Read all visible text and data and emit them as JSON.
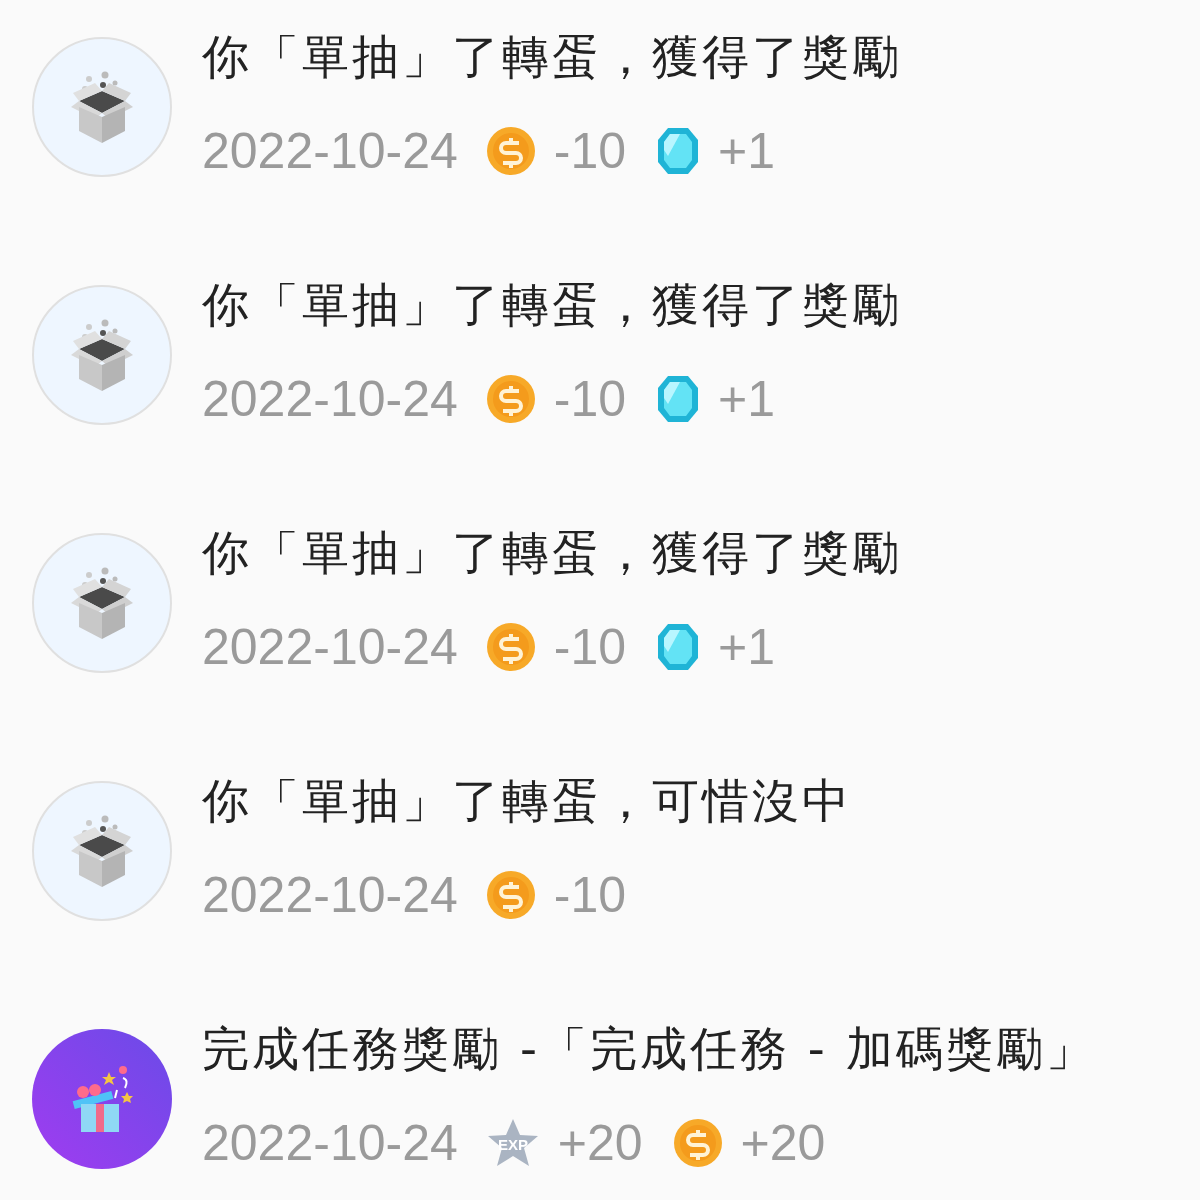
{
  "records": [
    {
      "kind": "box",
      "title": "你「單抽」了轉蛋，獲得了獎勵",
      "date": "2022-10-24",
      "rewards": [
        {
          "kind": "coin",
          "amount": "-10"
        },
        {
          "kind": "gem",
          "amount": "+1"
        }
      ]
    },
    {
      "kind": "box",
      "title": "你「單抽」了轉蛋，獲得了獎勵",
      "date": "2022-10-24",
      "rewards": [
        {
          "kind": "coin",
          "amount": "-10"
        },
        {
          "kind": "gem",
          "amount": "+1"
        }
      ]
    },
    {
      "kind": "box",
      "title": "你「單抽」了轉蛋，獲得了獎勵",
      "date": "2022-10-24",
      "rewards": [
        {
          "kind": "coin",
          "amount": "-10"
        },
        {
          "kind": "gem",
          "amount": "+1"
        }
      ]
    },
    {
      "kind": "box",
      "title": "你「單抽」了轉蛋，可惜沒中",
      "date": "2022-10-24",
      "rewards": [
        {
          "kind": "coin",
          "amount": "-10"
        }
      ]
    },
    {
      "kind": "gift",
      "title": "完成任務獎勵 -「完成任務 - 加碼獎勵」",
      "date": "2022-10-24",
      "rewards": [
        {
          "kind": "exp",
          "label": "EXP",
          "amount": "+20"
        },
        {
          "kind": "coin",
          "amount": "+20"
        }
      ]
    }
  ]
}
